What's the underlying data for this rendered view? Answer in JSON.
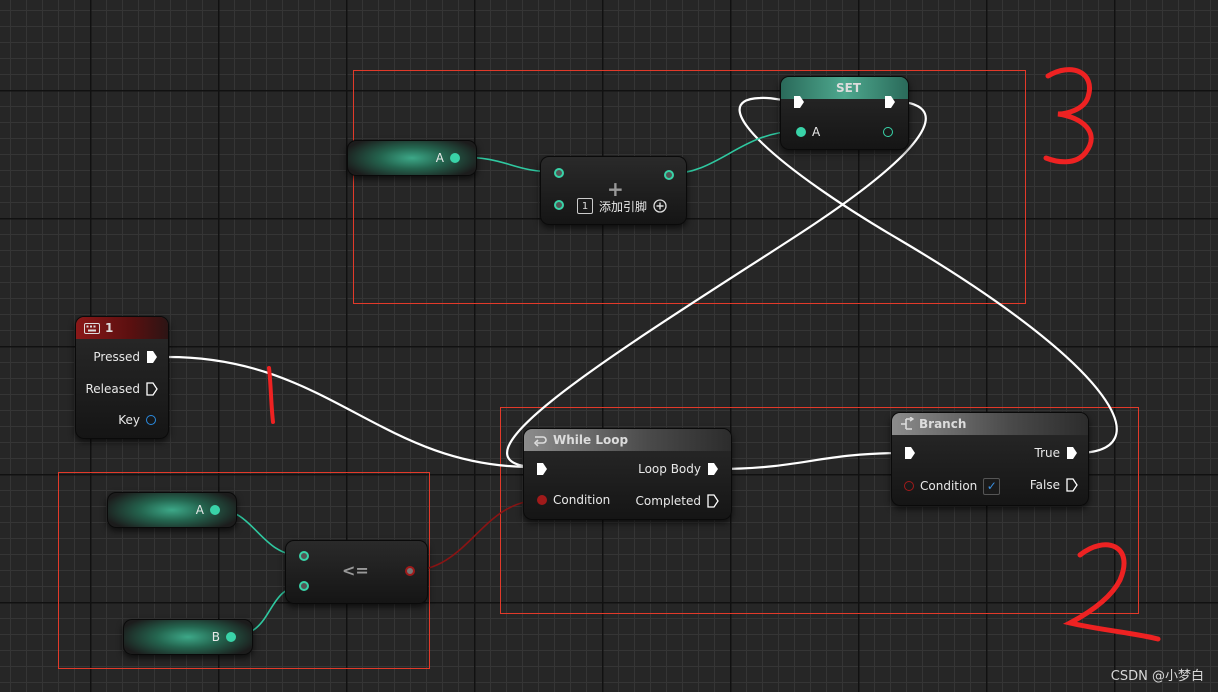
{
  "nodes": {
    "input_key": {
      "title": "1",
      "pins": {
        "pressed": "Pressed",
        "released": "Released",
        "key": "Key"
      }
    },
    "while_loop": {
      "title": "While Loop",
      "pins": {
        "condition": "Condition",
        "loop_body": "Loop Body",
        "completed": "Completed"
      }
    },
    "branch": {
      "title": "Branch",
      "pins": {
        "condition": "Condition",
        "true": "True",
        "false": "False"
      }
    },
    "set": {
      "title": "SET",
      "pins": {
        "a": "A"
      }
    },
    "get_a_top": {
      "label": "A"
    },
    "get_a_bottom": {
      "label": "A"
    },
    "get_b": {
      "label": "B"
    },
    "add": {
      "symbol": "+",
      "index": "1",
      "add_pin": "添加引脚"
    },
    "compare": {
      "symbol": "<="
    }
  },
  "annotations": {
    "one": "1",
    "two": "2",
    "three": "3"
  },
  "watermark": "CSDN @小梦白",
  "colors": {
    "exec_wire": "#ffffff",
    "float_wire": "#2fc8a0",
    "bool_wire": "#8a1414",
    "annotation_box": "#e23a2a",
    "annotation_ink": "#ee2222"
  },
  "icons": {
    "input_key": "keyboard-icon",
    "while_loop": "loop-icon",
    "branch": "branch-icon",
    "add_pin": "plus-circle-icon",
    "checkbox": "checkmark-icon"
  }
}
